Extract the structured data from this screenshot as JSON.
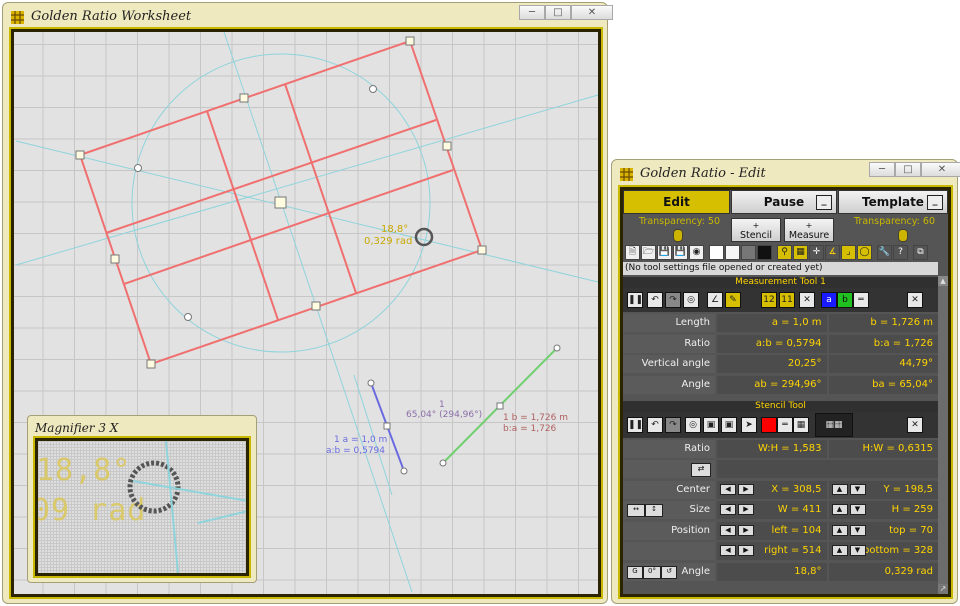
{
  "worksheet": {
    "title": "Golden Ratio Worksheet",
    "overlay_angle_deg": "18,8°",
    "overlay_angle_rad": "0,329 rad",
    "meas_a_label": "1 a = 1,0 m",
    "meas_ab_label": "a:b = 0,5794",
    "meas_angle_num": "1",
    "meas_angle_label": "65,04° (294,96°)",
    "meas_b_label": "1 b = 1,726 m",
    "meas_ba_label": "b:a = 1,726"
  },
  "magnifier": {
    "title": "Magnifier 3 X",
    "big_text1": "18,8°",
    "big_text2": "09 rad"
  },
  "edit": {
    "title": "Golden Ratio - Edit",
    "tabs": {
      "edit": "Edit",
      "pause": "Pause",
      "template": "Template"
    },
    "transparency_left": "Transparency: 50",
    "transparency_right": "Transparency: 60",
    "stencil_btn": "Stencil",
    "measure_btn": "Measure",
    "plus": "+",
    "status": "(No tool settings file opened or created yet)",
    "measurement_tool": {
      "header": "Measurement Tool 1",
      "btn_a": "a",
      "btn_b": "b",
      "rows": [
        {
          "label": "Length",
          "left": "a = 1,0 m",
          "right": "b = 1,726 m"
        },
        {
          "label": "Ratio",
          "left": "a:b = 0,5794",
          "right": "b:a = 1,726"
        },
        {
          "label": "Vertical angle",
          "left": "20,25°",
          "right": "44,79°"
        },
        {
          "label": "Angle",
          "left": "ab = 294,96°",
          "right": "ba = 65,04°"
        }
      ]
    },
    "stencil_tool": {
      "header": "Stencil Tool",
      "rows": [
        {
          "label": "Ratio",
          "left": "W:H = 1,583",
          "right": "H:W = 0,6315"
        },
        {
          "label": "",
          "left": "",
          "right": ""
        },
        {
          "label": "Center",
          "left": "X = 308,5",
          "right": "Y = 198,5"
        },
        {
          "label": "Size",
          "left": "W = 411",
          "right": "H = 259"
        },
        {
          "label": "Position",
          "left": "left = 104",
          "right": "top = 70"
        },
        {
          "label": "",
          "left": "right = 514",
          "right": "bottom = 328"
        },
        {
          "label": "Angle",
          "left": "18,8°",
          "right": "0,329 rad"
        }
      ]
    },
    "angle_mini_buttons": [
      "G",
      "0°"
    ]
  },
  "colors": {
    "accent_yellow": "#ffd400",
    "stencil_red": "#f07070",
    "guide_cyan": "#8fd4dc",
    "measure_blue": "#6a6ae0",
    "measure_green": "#70d070",
    "window_bg": "#efe9bf"
  }
}
